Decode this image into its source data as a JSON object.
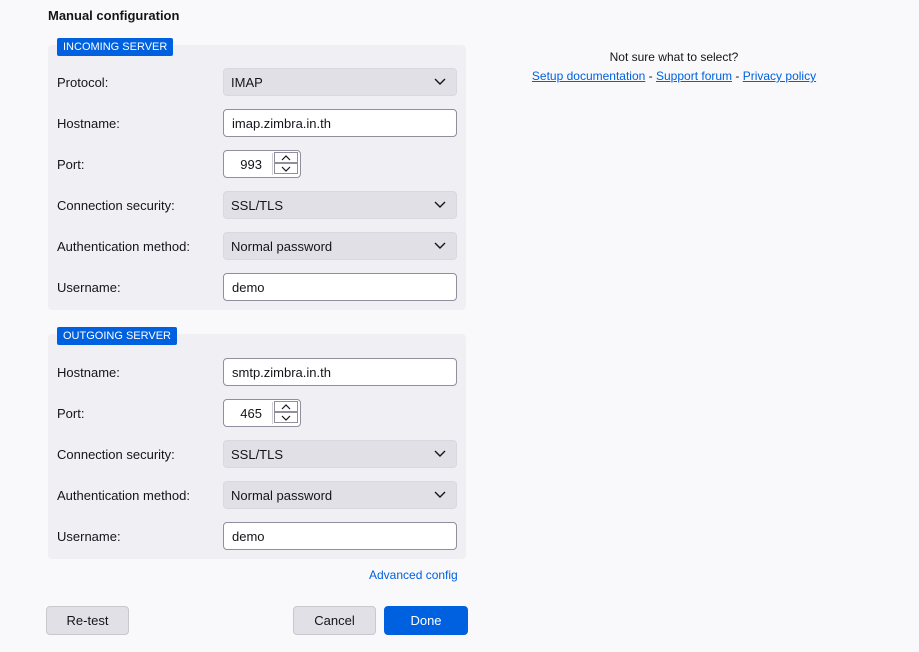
{
  "title": "Manual configuration",
  "incoming": {
    "badge": "INCOMING SERVER",
    "protocol_label": "Protocol:",
    "protocol_value": "IMAP",
    "hostname_label": "Hostname:",
    "hostname_value": "imap.zimbra.in.th",
    "port_label": "Port:",
    "port_value": "993",
    "security_label": "Connection security:",
    "security_value": "SSL/TLS",
    "auth_label": "Authentication method:",
    "auth_value": "Normal password",
    "username_label": "Username:",
    "username_value": "demo"
  },
  "outgoing": {
    "badge": "OUTGOING SERVER",
    "hostname_label": "Hostname:",
    "hostname_value": "smtp.zimbra.in.th",
    "port_label": "Port:",
    "port_value": "465",
    "security_label": "Connection security:",
    "security_value": "SSL/TLS",
    "auth_label": "Authentication method:",
    "auth_value": "Normal password",
    "username_label": "Username:",
    "username_value": "demo"
  },
  "help": {
    "question": "Not sure what to select?",
    "setup_doc": "Setup documentation",
    "sep1": " - ",
    "support_forum": "Support forum",
    "sep2": " - ",
    "privacy_policy": "Privacy policy"
  },
  "advanced_config": "Advanced config",
  "buttons": {
    "retest": "Re-test",
    "cancel": "Cancel",
    "done": "Done"
  },
  "colors": {
    "accent": "#0061e0",
    "panel": "#f0f0f4",
    "background": "#f9f9fb"
  },
  "icons": {
    "dropdown": "chevron-down-icon",
    "spin_up": "chevron-up-icon",
    "spin_down": "chevron-down-icon"
  }
}
